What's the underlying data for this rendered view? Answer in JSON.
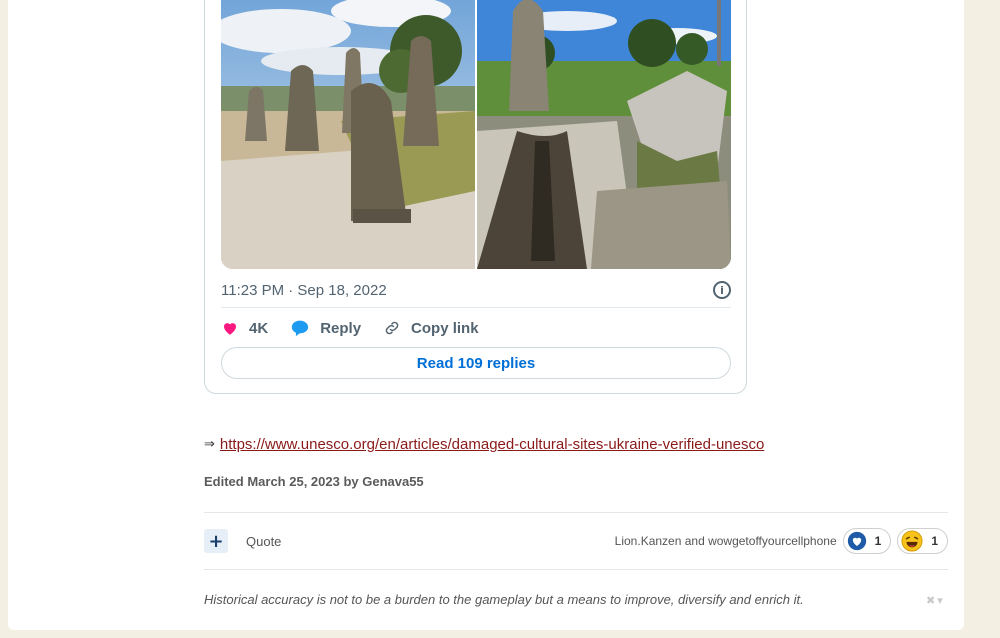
{
  "embed": {
    "timestamp": "11:23 PM · Sep 18, 2022",
    "likes_count": "4K",
    "reply_label": "Reply",
    "copy_link_label": "Copy link",
    "read_replies_label": "Read 109 replies"
  },
  "post": {
    "link_arrow": "⇒",
    "link_url": "https://www.unesco.org/en/articles/damaged-cultural-sites-ukraine-verified-unesco",
    "edited_text": "Edited March 25, 2023 by Genava55"
  },
  "footer": {
    "plus_label": "+",
    "quote_label": "Quote",
    "reactors_text": "Lion.Kanzen and wowgetoffyourcellphone",
    "reactions": [
      {
        "icon": "like-icon",
        "count": "1"
      },
      {
        "icon": "laugh-icon",
        "count": "1"
      }
    ]
  },
  "signature": {
    "text": "Historical accuracy is not to be a burden to the gameplay but a means to improve, diversify and enrich it."
  },
  "colors": {
    "link": "#8a1a1a",
    "accent_blue": "#006fd6",
    "like_pink": "#f91880",
    "page_bg": "#f3efe2"
  }
}
